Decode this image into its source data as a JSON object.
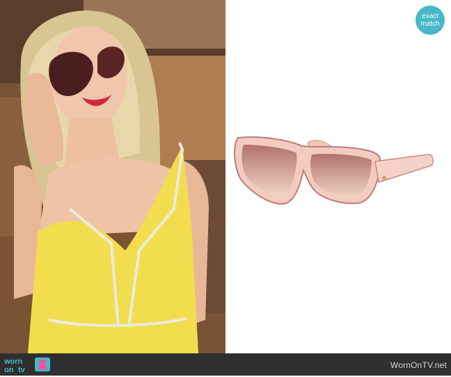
{
  "badge": {
    "line1": "exact",
    "line2": "match"
  },
  "footer": {
    "logo_text_1": "worn",
    "logo_text_2": "on",
    "logo_text_3": "tv",
    "site": "WornOnTV.net"
  },
  "colors": {
    "badge_bg": "#46b8c7",
    "footer_bg": "#2f2f2f",
    "dress_yellow": "#f2dd4f"
  },
  "icons": [
    "dress-icon"
  ]
}
